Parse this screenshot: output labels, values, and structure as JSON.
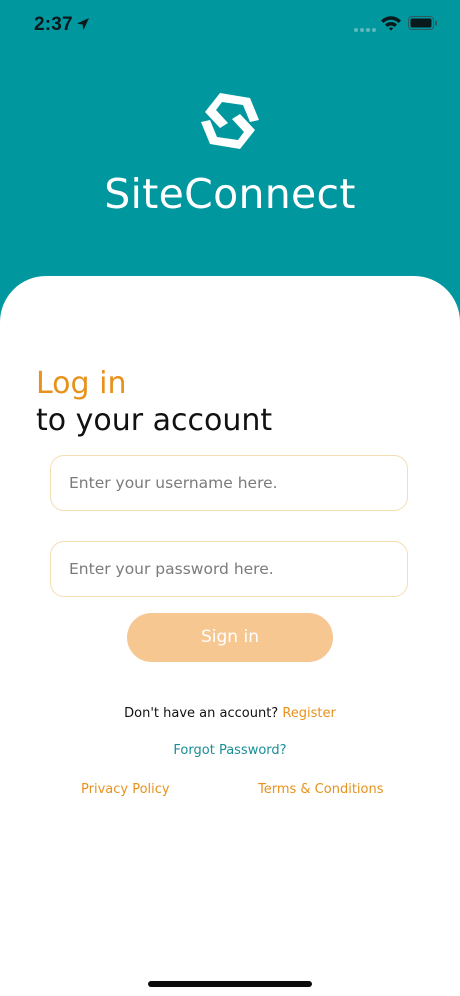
{
  "status_bar": {
    "time": "2:37"
  },
  "header": {
    "app_title": "SiteConnect"
  },
  "login": {
    "heading": "Log in",
    "subheading": "to your account",
    "username_placeholder": "Enter your username here.",
    "password_placeholder": "Enter your password here.",
    "signin_label": "Sign in",
    "no_account_text": "Don't have an account?",
    "register_label": "Register",
    "forgot_password_label": "Forgot Password?",
    "privacy_label": "Privacy Policy",
    "terms_label": "Terms & Conditions"
  },
  "colors": {
    "brand_teal": "#00979f",
    "accent_orange": "#e8921c",
    "button_peach": "#f7c792"
  },
  "icons": {
    "location": "location-arrow-icon",
    "signal": "cellular-signal-icon",
    "wifi": "wifi-icon",
    "battery": "battery-icon",
    "logo": "siteconnect-logo-icon"
  }
}
